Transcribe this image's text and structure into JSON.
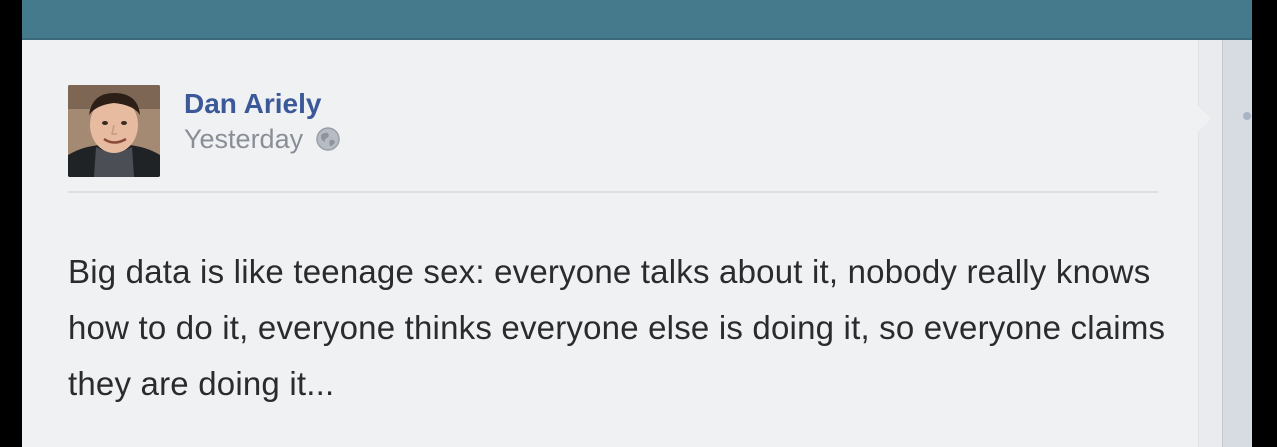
{
  "post": {
    "author": "Dan Ariely",
    "timestamp": "Yesterday",
    "audience_icon": "globe-icon",
    "text": "Big data is like teenage sex: everyone talks about it, nobody really knows how to do it, everyone thinks everyone else is doing it, so everyone claims they are doing it..."
  },
  "colors": {
    "topbar": "#457a8c",
    "author_link": "#3b5998",
    "timestamp": "#8a8f97",
    "body_text": "#2a2b2e",
    "card_bg": "#f0f1f2"
  }
}
